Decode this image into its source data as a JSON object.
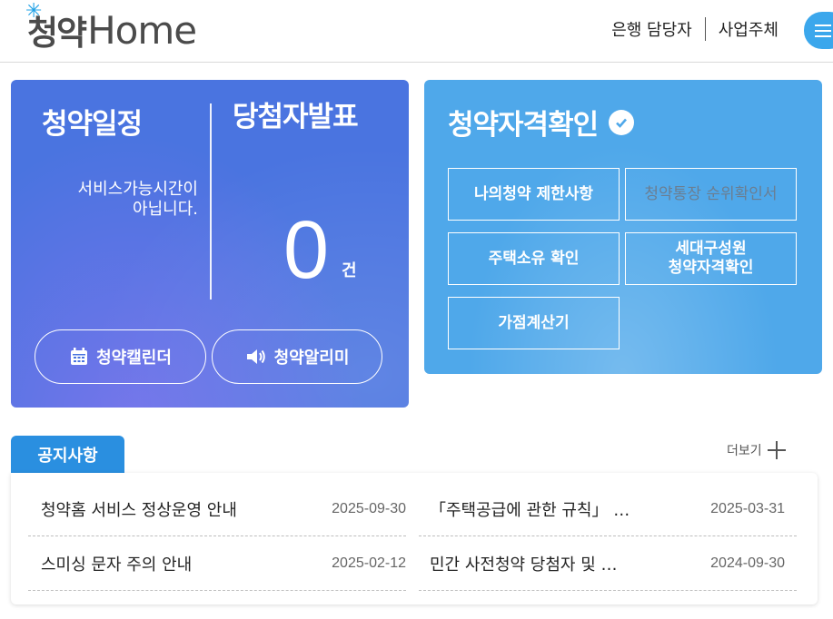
{
  "header": {
    "logo_korean": "청약",
    "logo_english": "Home",
    "links": [
      "은행 담당자",
      "사업주체"
    ],
    "menu_icon": "hamburger-icon"
  },
  "schedule": {
    "title": "청약일정",
    "message_line1": "서비스가능시간이",
    "message_line2": "아닙니다."
  },
  "winners": {
    "title": "당첨자발표",
    "count": "0",
    "unit": "건"
  },
  "buttons": {
    "calendar": "청약캘린더",
    "alarm": "청약알리미"
  },
  "eligibility": {
    "title": "청약자격확인",
    "items": [
      {
        "label": "나의청약 제한사항",
        "dim": false
      },
      {
        "label": "청약통장 순위확인서",
        "dim": true
      },
      {
        "label": "주택소유 확인",
        "dim": false
      },
      {
        "label_line1": "세대구성원",
        "label_line2": "청약자격확인",
        "dim": false
      },
      {
        "label": "가점계산기",
        "dim": false
      }
    ]
  },
  "notices": {
    "tab_label": "공지사항",
    "more_label": "더보기",
    "items": [
      {
        "title": "청약홈 서비스 정상운영 안내",
        "date": "2025-09-30"
      },
      {
        "title": "「주택공급에 관한 규칙」 …",
        "date": "2025-03-31"
      },
      {
        "title": "스미싱 문자 주의 안내",
        "date": "2025-02-12"
      },
      {
        "title": "민간 사전청약 당첨자 및 …",
        "date": "2024-09-30"
      }
    ]
  },
  "colors": {
    "schedule_card": "#4a74e0",
    "eligibility_card": "#4fa8ea",
    "notice_tab": "#2a8fe0",
    "menu_button": "#3ba7ec"
  }
}
